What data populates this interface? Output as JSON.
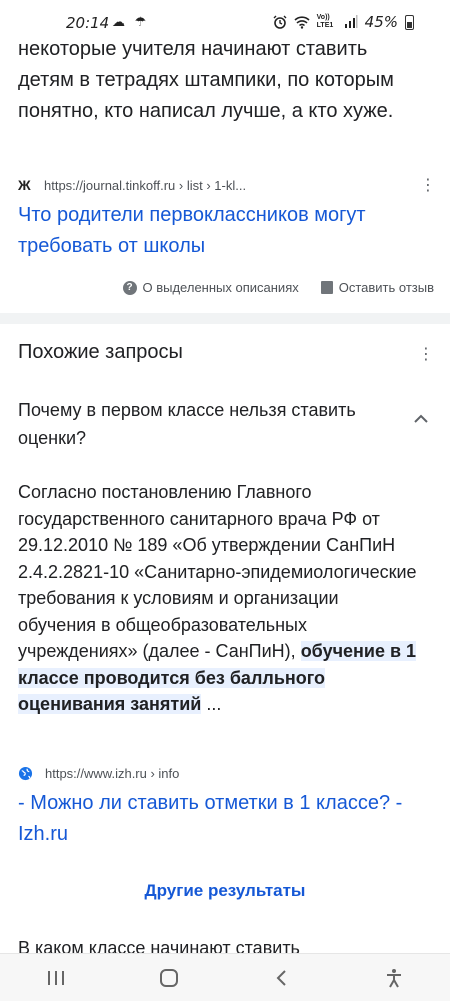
{
  "status_bar": {
    "time": "20:14",
    "left_icons": "☁ ☂",
    "network": "Vo)) LTE1",
    "battery": "45%",
    "icons": [
      "alarm-icon",
      "wifi-icon",
      "signal-icon",
      "battery-icon"
    ]
  },
  "snippet_top": {
    "text": "некоторые учителя начинают ставить детям в тетрадях штампики, по которым понятно, кто написал лучше, а кто хуже."
  },
  "result1": {
    "favicon": "Ж",
    "url": "https://journal.tinkoff.ru › list › 1-kl...",
    "title": "Что родители первоклассников могут требовать от школы"
  },
  "feedback": {
    "about": "О выделенных описаниях",
    "feedback": "Оставить отзыв"
  },
  "related": {
    "header": "Похожие запросы",
    "question": "Почему в первом классе нельзя ставить оценки?",
    "answer_plain": "Согласно постановлению Главного государственного санитарного врача РФ от 29.12.2010 № 189 «Об утверждении СанПиН 2.4.2.2821-10 «Санитарно-эпидемиологические требования к условиям и организации обучения в общеобразовательных учреждениях» (далее - СанПиН), ",
    "answer_highlight": "обучение в 1 классе проводится без балльного оценивания занятий",
    "answer_tail": " ...",
    "source_url": "https://www.izh.ru › info",
    "source_title": "- Можно ли ставить отметки в 1 классе? - Izh.ru",
    "more_results": "Другие результаты",
    "next_question": "В каком классе начинают ставить"
  },
  "colors": {
    "link": "#1558d6",
    "text": "#202124",
    "secondary": "#4d5156",
    "highlight": "#e8f0fe"
  }
}
